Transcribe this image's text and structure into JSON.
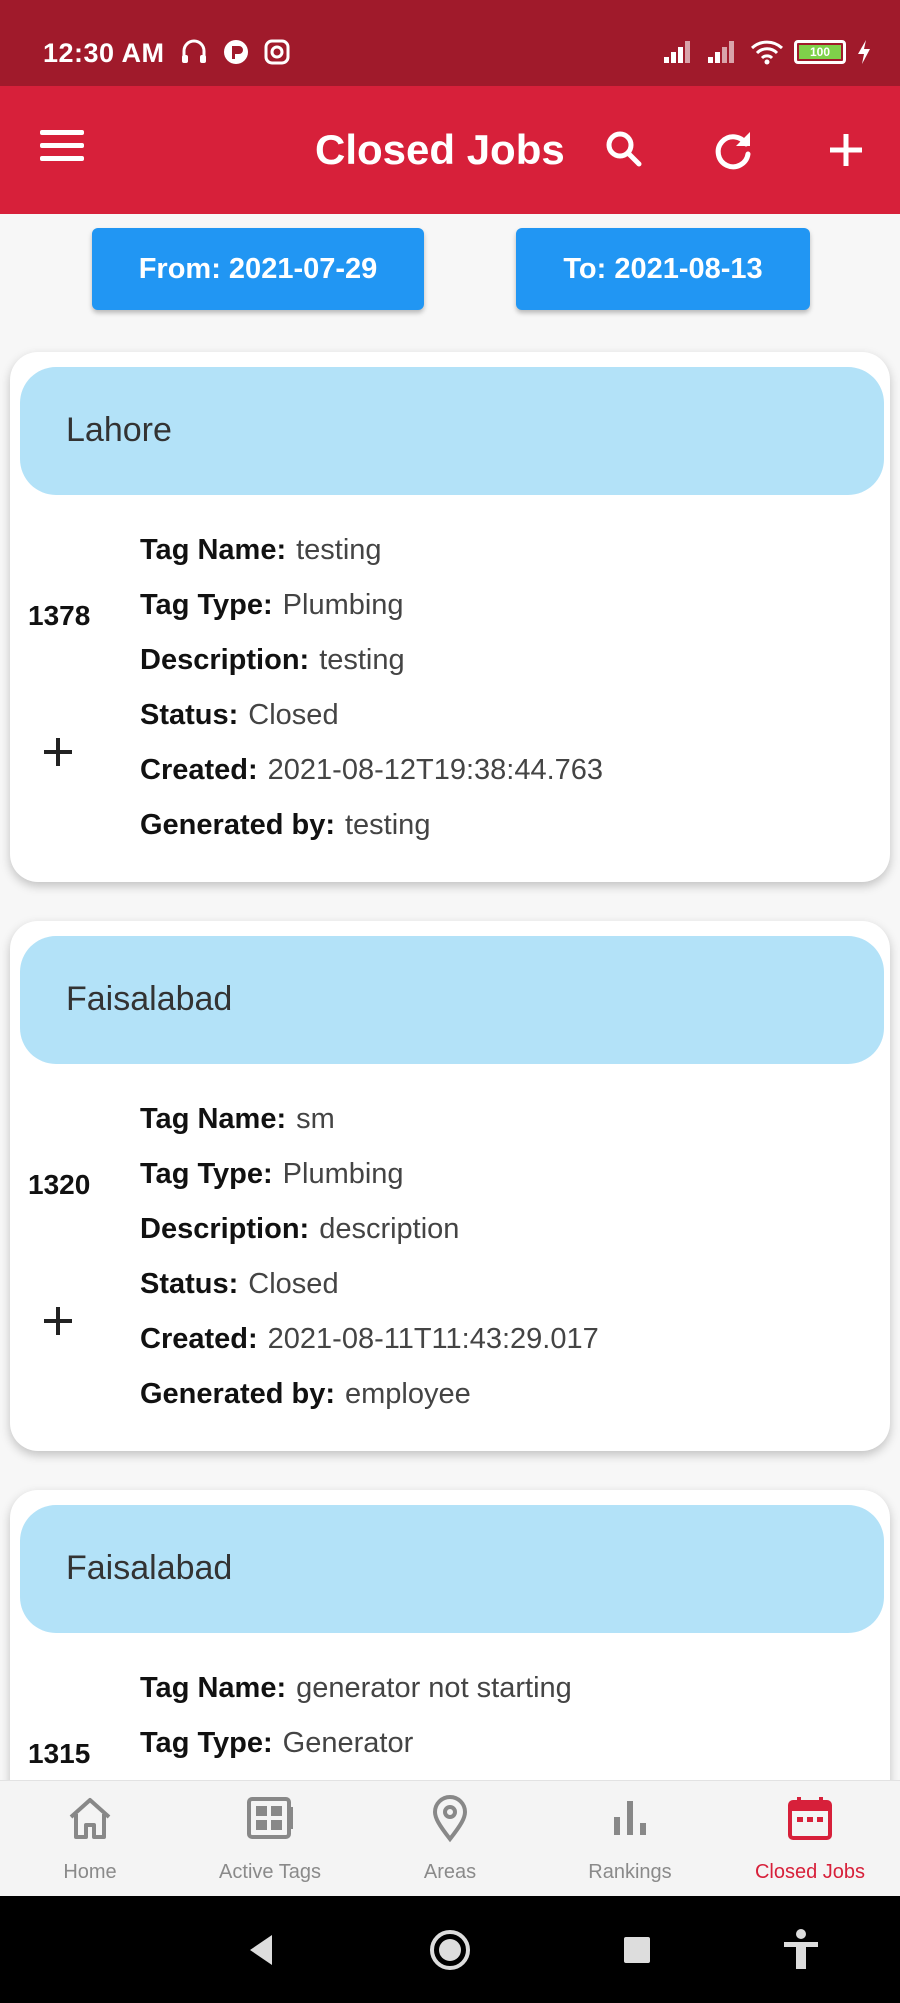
{
  "status_bar": {
    "time": "12:30 AM",
    "battery_text": "100",
    "battery_level": 1.0,
    "left_icons": [
      "headset-icon",
      "app-circle-icon",
      "instagram-icon"
    ],
    "right_icons": [
      "signal-icon",
      "signal-icon",
      "wifi-icon",
      "battery-icon",
      "charging-icon"
    ]
  },
  "app_bar": {
    "title": "Closed Jobs",
    "menu_icon": "menu-icon",
    "actions": [
      "search-icon",
      "refresh-icon",
      "add-icon"
    ],
    "background": "#d7203a"
  },
  "filters": {
    "from_label": "From: 2021-07-29",
    "to_label": "To: 2021-08-13",
    "color": "#2196f3"
  },
  "labels": {
    "tag_name": "Tag Name:",
    "tag_type": "Tag Type:",
    "description": "Description:",
    "status": "Status:",
    "created": "Created:",
    "generated_by": "Generated by:"
  },
  "jobs": [
    {
      "city": "Lahore",
      "id": "1378",
      "tag_name": "testing",
      "tag_type": "Plumbing",
      "description": "testing",
      "status": "Closed",
      "created": "2021-08-12T19:38:44.763",
      "generated_by": "testing"
    },
    {
      "city": "Faisalabad",
      "id": "1320",
      "tag_name": "sm",
      "tag_type": "Plumbing",
      "description": "description",
      "status": "Closed",
      "created": "2021-08-11T11:43:29.017",
      "generated_by": "employee"
    },
    {
      "city": "Faisalabad",
      "id": "1315",
      "tag_name": "generator not starting",
      "tag_type": "Generator",
      "description": "",
      "status": "",
      "created": "",
      "generated_by": ""
    }
  ],
  "bottom_nav": {
    "items": [
      {
        "label": "Home",
        "icon": "home-icon"
      },
      {
        "label": "Active Tags",
        "icon": "tag-board-icon"
      },
      {
        "label": "Areas",
        "icon": "location-pin-icon"
      },
      {
        "label": "Rankings",
        "icon": "bar-chart-icon"
      },
      {
        "label": "Closed Jobs",
        "icon": "calendar-icon"
      }
    ],
    "active_index": 4,
    "active_color": "#d7203a"
  },
  "system_nav": [
    "back-icon",
    "home-circle-icon",
    "recents-icon",
    "accessibility-icon"
  ]
}
